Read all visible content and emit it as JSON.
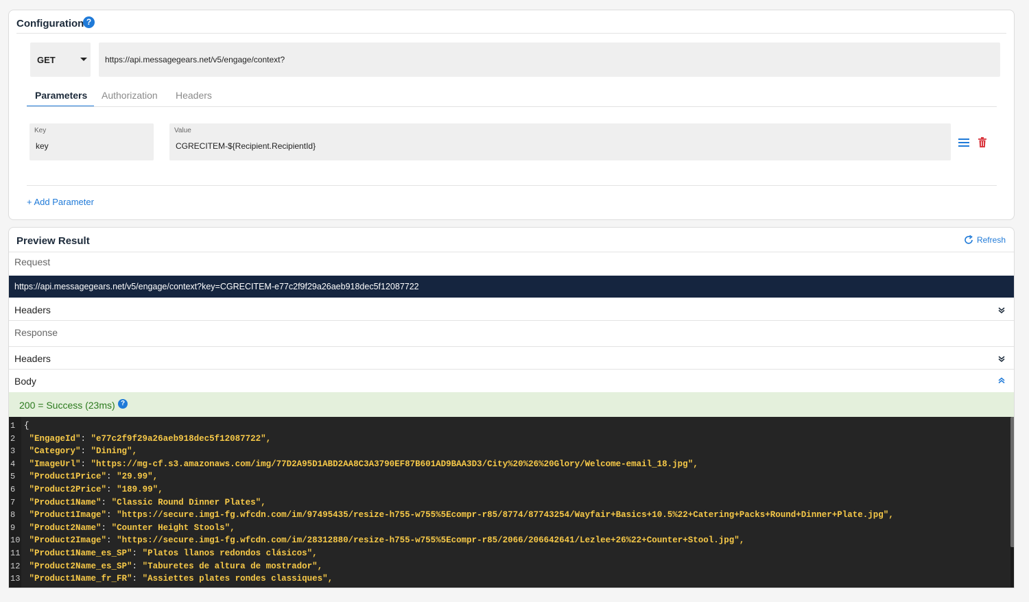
{
  "config": {
    "title": "Configuration",
    "help_glyph": "?",
    "method": "GET",
    "url": "https://api.messagegears.net/v5/engage/context?",
    "tabs": [
      "Parameters",
      "Authorization",
      "Headers"
    ],
    "active_tab": "Parameters",
    "param": {
      "key_label": "Key",
      "key_value": "key",
      "value_label": "Value",
      "value_value": "CGRECITEM-${Recipient.RecipientId}"
    },
    "add_parameter": "+ Add Parameter",
    "colors": {
      "accent": "#1f7ad8",
      "delete": "#d9363e"
    },
    "icons": [
      "help-icon",
      "caret-down-icon",
      "menu-icon",
      "trash-icon"
    ]
  },
  "preview": {
    "title": "Preview Result",
    "refresh": "Refresh",
    "request_label": "Request",
    "request_url": "https://api.messagegears.net/v5/engage/context?key=CGRECITEM-e77c2f9f29a26aeb918dec5f12087722",
    "request_headers": "Headers",
    "response_label": "Response",
    "response_headers": "Headers",
    "body_label": "Body",
    "status": "200 = Success (23ms)",
    "colors": {
      "request_bar": "#15253f",
      "status_bg": "#e4f0dc",
      "status_text": "#2b7a1d",
      "code_bg": "#252525",
      "code_text": "#f7c948"
    },
    "icons": [
      "refresh-icon",
      "chevron-down-icon",
      "chevron-up-icon",
      "help-icon"
    ],
    "code_lines": [
      {
        "n": "1",
        "key": "",
        "value": "",
        "raw": "{"
      },
      {
        "n": "2",
        "key": "\"EngageId\"",
        "value": "\"e77c2f9f29a26aeb918dec5f12087722\","
      },
      {
        "n": "3",
        "key": "\"Category\"",
        "value": "\"Dining\","
      },
      {
        "n": "4",
        "key": "\"ImageUrl\"",
        "value": "\"https://mg-cf.s3.amazonaws.com/img/77D2A95D1ABD2AA8C3A3790EF87B601AD9BAA3D3/City%20%26%20Glory/Welcome-email_18.jpg\","
      },
      {
        "n": "5",
        "key": "\"Product1Price\"",
        "value": "\"29.99\","
      },
      {
        "n": "6",
        "key": "\"Product2Price\"",
        "value": "\"189.99\","
      },
      {
        "n": "7",
        "key": "\"Product1Name\"",
        "value": "\"Classic Round Dinner Plates\","
      },
      {
        "n": "8",
        "key": "\"Product1Image\"",
        "value": "\"https://secure.img1-fg.wfcdn.com/im/97495435/resize-h755-w755%5Ecompr-r85/8774/87743254/Wayfair+Basics+10.5%22+Catering+Packs+Round+Dinner+Plate.jpg\","
      },
      {
        "n": "9",
        "key": "\"Product2Name\"",
        "value": "\"Counter Height Stools\","
      },
      {
        "n": "10",
        "key": "\"Product2Image\"",
        "value": "\"https://secure.img1-fg.wfcdn.com/im/28312880/resize-h755-w755%5Ecompr-r85/2066/206642641/Lezlee+26%22+Counter+Stool.jpg\","
      },
      {
        "n": "11",
        "key": "\"Product1Name_es_SP\"",
        "value": "\"Platos llanos redondos clásicos\","
      },
      {
        "n": "12",
        "key": "\"Product2Name_es_SP\"",
        "value": "\"Taburetes de altura de mostrador\","
      },
      {
        "n": "13",
        "key": "\"Product1Name_fr_FR\"",
        "value": "\"Assiettes plates rondes classiques\","
      }
    ]
  }
}
